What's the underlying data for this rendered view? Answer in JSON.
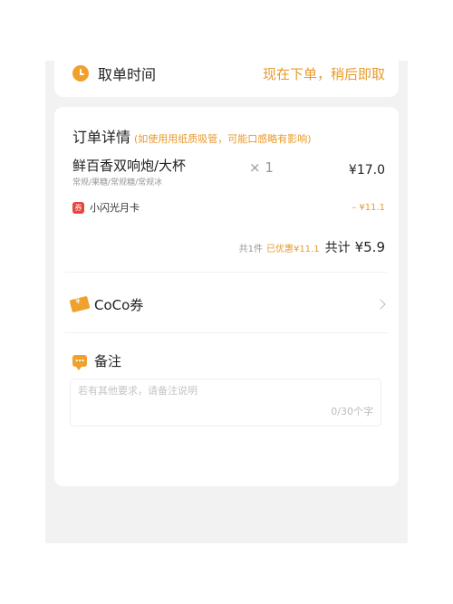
{
  "pickup": {
    "label": "取单时间",
    "value": "现在下单，稍后即取"
  },
  "order": {
    "title": "订单详情",
    "note": "(如使用用纸质吸管，可能口感略有影响)",
    "product": {
      "name": "鲜百香双响炮/大杯",
      "spec": "常规/果糖/常规糖/常规冰",
      "qty": "× 1",
      "price": "¥17.0"
    },
    "coupon": {
      "tag": "券",
      "name": "小闪光月卡",
      "discount": "– ¥11.1"
    },
    "total": {
      "count": "共1件",
      "saving": "已优惠¥11.1",
      "label": "共计",
      "amount": "¥5.9"
    }
  },
  "voucher": {
    "label": "CoCo券"
  },
  "remark": {
    "label": "备注",
    "placeholder": "若有其他要求，请备注说明",
    "counter": "0/30个字"
  },
  "colors": {
    "accent": "#f0a12c",
    "accent_text": "#e89a2c",
    "coupon_tag": "#e8453c",
    "background": "#f2f2f2"
  },
  "icons": [
    "clock-icon",
    "coupon-tag-icon",
    "voucher-ticket-icon",
    "chevron-right-icon",
    "chat-bubble-icon"
  ]
}
